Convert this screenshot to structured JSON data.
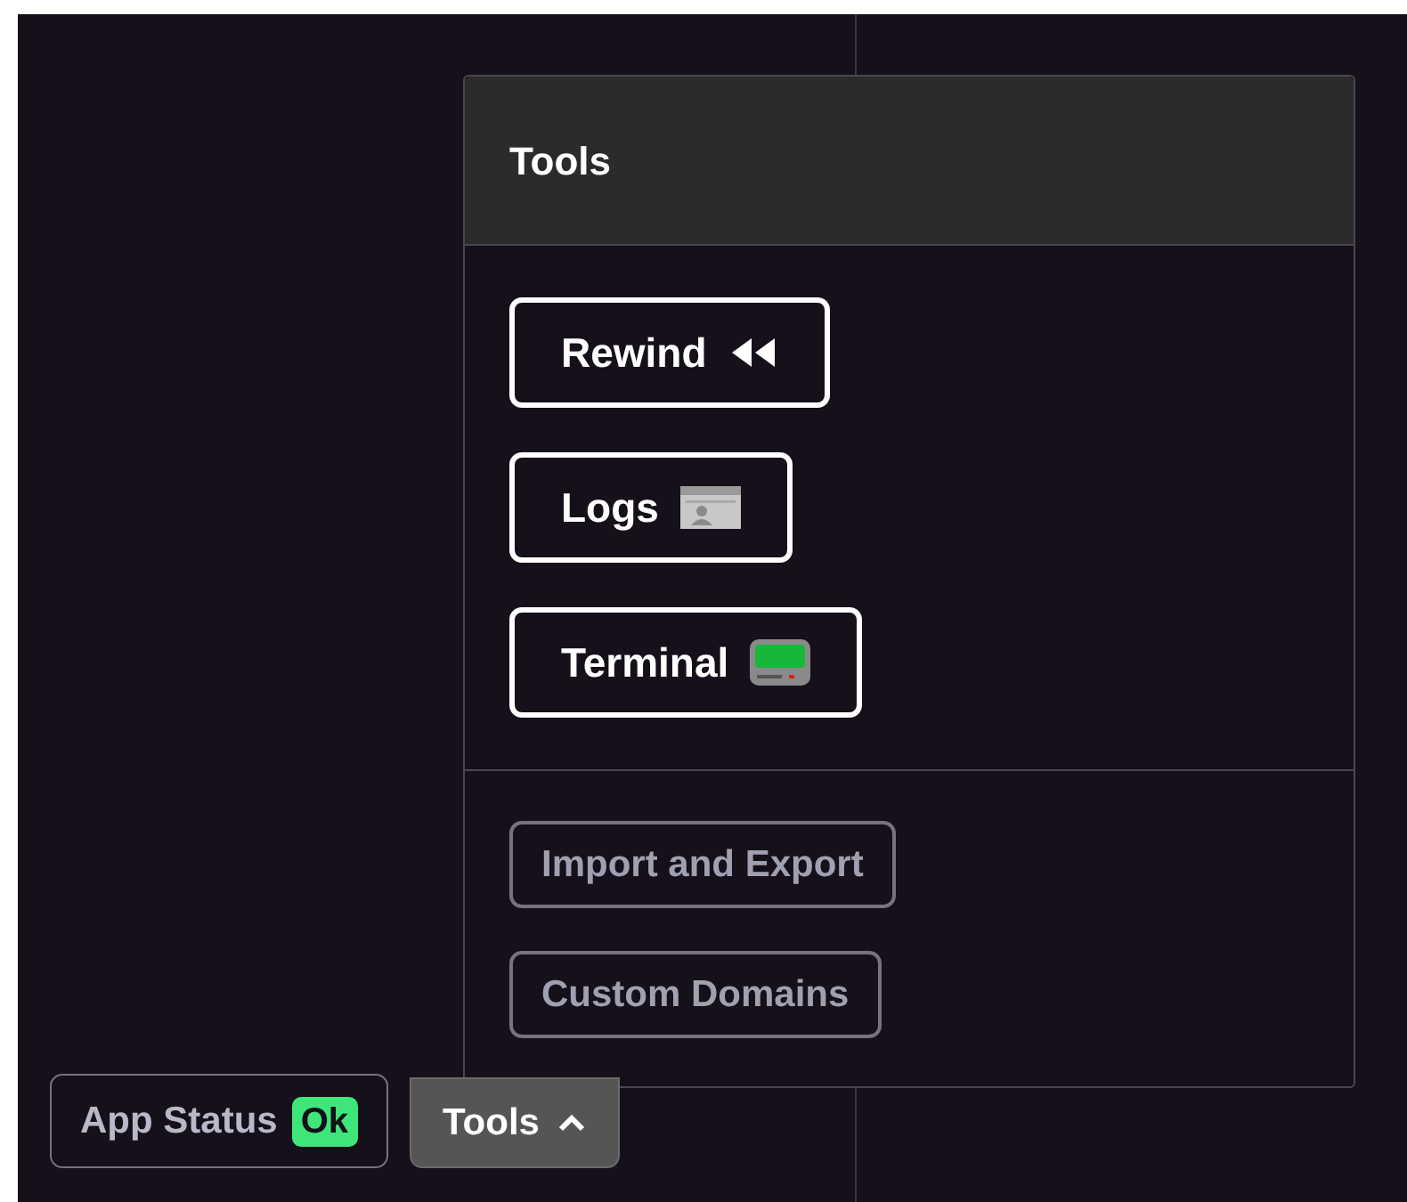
{
  "tools_menu": {
    "title": "Tools",
    "tools": [
      {
        "label": "Rewind",
        "kind": "rewind"
      },
      {
        "label": "Logs",
        "kind": "logs"
      },
      {
        "label": "Terminal",
        "kind": "terminal"
      }
    ],
    "more_tools": [
      "Import and Export",
      "Custom Domains"
    ]
  },
  "footer": {
    "app_status": {
      "label": "App Status",
      "value": "Ok"
    },
    "tools_button": {
      "label": "Tools",
      "expanded": true
    }
  }
}
